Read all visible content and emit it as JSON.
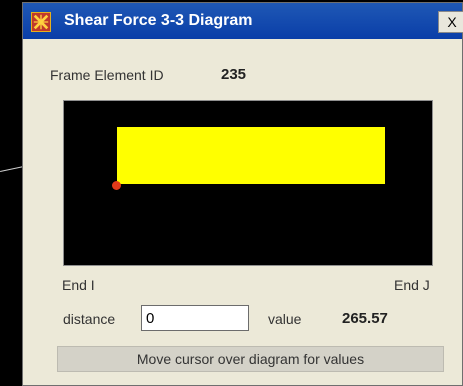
{
  "window": {
    "title": "Shear Force 3-3 Diagram",
    "close_glyph": "X",
    "app_icon": "app-logo-icon"
  },
  "element": {
    "label": "Frame Element ID",
    "id": "235"
  },
  "diagram": {
    "end_i_label": "End I",
    "end_j_label": "End J",
    "fill_color": "#ffff00",
    "background_color": "#000000",
    "node_color": "#e23a1a"
  },
  "controls": {
    "distance_label": "distance",
    "distance_value": "0",
    "value_label": "value",
    "value": "265.57"
  },
  "status": {
    "text": "Move cursor over diagram for values"
  }
}
